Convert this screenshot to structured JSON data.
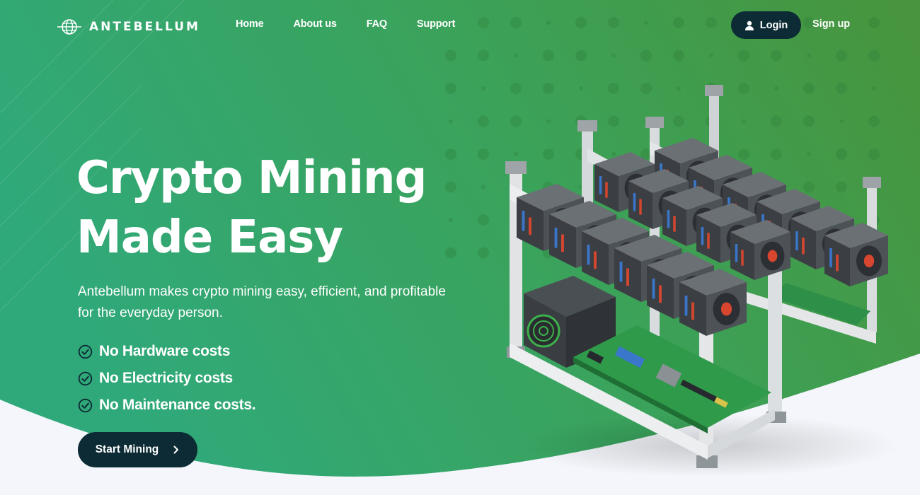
{
  "brand": {
    "name": "ANTEBELLUM",
    "icon": "globe-icon"
  },
  "nav": {
    "links": [
      "Home",
      "About us",
      "FAQ",
      "Support"
    ],
    "login_label": "Login",
    "signup_label": "Sign up"
  },
  "hero": {
    "headline_line1": "Crypto Mining",
    "headline_line2": "Made Easy",
    "subtitle": "Antebellum makes crypto mining easy, efficient, and profitable for the everyday person.",
    "features": [
      "No Hardware costs",
      "No Electricity costs",
      "No Maintenance costs."
    ],
    "cta_label": "Start Mining"
  },
  "colors": {
    "gradient_left": "#2fa87a",
    "gradient_right": "#43953f",
    "dark_button": "#0c2b34",
    "background_bottom": "#f4f6fb"
  }
}
